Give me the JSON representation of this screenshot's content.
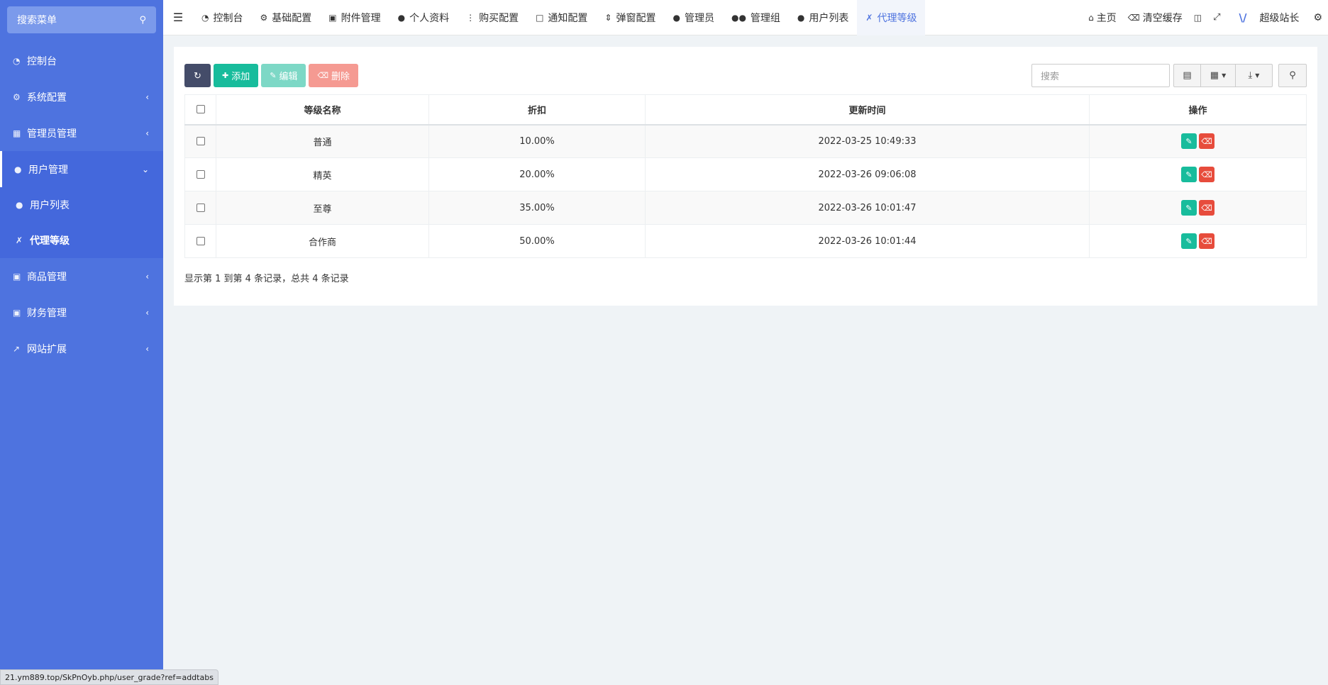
{
  "sidebar": {
    "search_placeholder": "搜索菜单",
    "items": [
      {
        "label": "控制台",
        "icon": "dashboard-icon",
        "glyph": "◔"
      },
      {
        "label": "系统配置",
        "icon": "cogs-icon",
        "glyph": "⚙"
      },
      {
        "label": "管理员管理",
        "icon": "windows-icon",
        "glyph": "▦"
      },
      {
        "label": "用户管理",
        "icon": "user-icon",
        "glyph": "👤"
      },
      {
        "label": "用户列表",
        "icon": "user-icon",
        "glyph": "👤"
      },
      {
        "label": "代理等级",
        "icon": "tag-icon",
        "glyph": "✗"
      },
      {
        "label": "商品管理",
        "icon": "cart-icon",
        "glyph": "🛒"
      },
      {
        "label": "财务管理",
        "icon": "ledger-icon",
        "glyph": "▣"
      },
      {
        "label": "网站扩展",
        "icon": "external-link-icon",
        "glyph": "↗"
      }
    ]
  },
  "topbar": {
    "tabs": [
      {
        "label": "控制台",
        "glyph": "◔"
      },
      {
        "label": "基础配置",
        "glyph": "⚙"
      },
      {
        "label": "附件管理",
        "glyph": "🖼"
      },
      {
        "label": "个人资料",
        "glyph": "👤"
      },
      {
        "label": "购买配置",
        "glyph": "⋮"
      },
      {
        "label": "通知配置",
        "glyph": "💬"
      },
      {
        "label": "弹窗配置",
        "glyph": "⇕"
      },
      {
        "label": "管理员",
        "glyph": "👤"
      },
      {
        "label": "管理组",
        "glyph": "👥"
      },
      {
        "label": "用户列表",
        "glyph": "👤"
      },
      {
        "label": "代理等级",
        "glyph": "✗"
      }
    ],
    "home_label": "主页",
    "clear_cache_label": "清空缓存",
    "user_name": "超级站长",
    "user_logo": "\\/"
  },
  "toolbar": {
    "add_label": "添加",
    "edit_label": "编辑",
    "delete_label": "删除",
    "search_placeholder": "搜索"
  },
  "table": {
    "headers": [
      "等级名称",
      "折扣",
      "更新时间",
      "操作"
    ],
    "rows": [
      {
        "name": "普通",
        "discount": "10.00%",
        "updated": "2022-03-25 10:49:33"
      },
      {
        "name": "精英",
        "discount": "20.00%",
        "updated": "2022-03-26 09:06:08"
      },
      {
        "name": "至尊",
        "discount": "35.00%",
        "updated": "2022-03-26 10:01:47"
      },
      {
        "name": "合作商",
        "discount": "50.00%",
        "updated": "2022-03-26 10:01:44"
      }
    ]
  },
  "summary": "显示第 1 到第 4 条记录，总共 4 条记录",
  "status_url": "21.ym889.top/SkPnOyb.php/user_grade?ref=addtabs",
  "colors": {
    "sidebar": "#4e73df",
    "accent": "#4e73df",
    "success": "#18bc9c",
    "danger": "#e74c3c"
  }
}
